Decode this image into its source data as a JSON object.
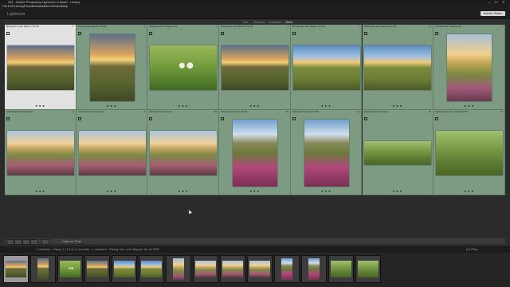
{
  "window": {
    "title": "361 - Adobe Photoshop Lightroom Classic - Library",
    "controls": [
      "—",
      "☐",
      "✕"
    ]
  },
  "menu": [
    "File",
    "Edit",
    "Library",
    "Photo",
    "Metadata",
    "View",
    "Window",
    "Help"
  ],
  "identity_plate": {
    "logo": "Lightroom",
    "share_label": "Adobe Share"
  },
  "library_filter": {
    "tabs": [
      "Text",
      "Attribute",
      "Metadata",
      "None"
    ],
    "active": "None"
  },
  "grid_rows": [
    [
      {
        "info": "Rising Sun over Rippon Tor #2",
        "num": "1",
        "selected": true,
        "orientation": "landscape",
        "scene": "sunset-hills"
      },
      {
        "info": "Sunrise over Rippon Tor #2",
        "num": "2",
        "orientation": "portrait",
        "scene": "sunset-hills"
      },
      {
        "info": "Mushrooms on Rippon Tor",
        "num": "3",
        "orientation": "landscape",
        "scene": "mushrooms"
      },
      {
        "info": "Rising Sun over Rippon Tor #1",
        "num": "4",
        "orientation": "landscape",
        "scene": "sunset-hills"
      },
      {
        "info": "Rising Sun over Rippon Tor #4",
        "num": "5",
        "orientation": "landscape",
        "scene": "blue-hills"
      },
      {
        "info": "Rising Sun over Rippon Tor #3",
        "num": "6",
        "orientation": "landscape",
        "scene": "blue-hills"
      },
      {
        "info": "Chinkwell Tor Sunrise #3",
        "num": "7",
        "orientation": "portrait",
        "scene": "heather-sunrise"
      }
    ],
    [
      {
        "info": "Chinkwell Tor Sunrise #2",
        "num": "8",
        "orientation": "landscape",
        "scene": "heather-rocks"
      },
      {
        "info": "Chinkwell Tor Sunrise #1",
        "num": "9",
        "orientation": "landscape",
        "scene": "heather-rocks"
      },
      {
        "info": "Chinkwell Tor Summit",
        "num": "10",
        "orientation": "landscape",
        "scene": "heather-rocks"
      },
      {
        "info": "Chinkwell Tor Summit #2",
        "num": "11",
        "orientation": "portrait",
        "scene": "heather-boulders"
      },
      {
        "info": "Chinkwell Tor Summit #3",
        "num": "12",
        "orientation": "portrait",
        "scene": "heather-boulders"
      },
      {
        "info": "Widecombe Panorama",
        "num": "13",
        "orientation": "panorama",
        "scene": "valley"
      },
      {
        "info": "Widecombe from Chinkwell Tor",
        "num": "14",
        "orientation": "landscape",
        "scene": "valley"
      }
    ]
  ],
  "toolbar": {
    "sort_label": "Capture Time"
  },
  "filmstrip_bar": {
    "breadcrumb": "Collection : Dtacy 1 | 14 of | Currently : 1 selected : Rising Sun over Rippon Tor #1.NEF",
    "filter_label": "No Filter"
  },
  "filmstrip": [
    {
      "scene": "sunset-hills",
      "orientation": "landscape",
      "selected": true
    },
    {
      "scene": "sunset-hills",
      "orientation": "portrait"
    },
    {
      "scene": "mushrooms",
      "orientation": "landscape"
    },
    {
      "scene": "sunset-hills",
      "orientation": "landscape"
    },
    {
      "scene": "blue-hills",
      "orientation": "landscape"
    },
    {
      "scene": "blue-hills",
      "orientation": "landscape"
    },
    {
      "scene": "heather-sunrise",
      "orientation": "portrait"
    },
    {
      "scene": "heather-rocks",
      "orientation": "landscape"
    },
    {
      "scene": "heather-rocks",
      "orientation": "landscape"
    },
    {
      "scene": "heather-rocks",
      "orientation": "landscape"
    },
    {
      "scene": "heather-boulders",
      "orientation": "portrait"
    },
    {
      "scene": "heather-boulders",
      "orientation": "portrait"
    },
    {
      "scene": "valley",
      "orientation": "landscape"
    },
    {
      "scene": "valley",
      "orientation": "landscape"
    }
  ],
  "colors": {
    "grid_cell": "#7d9a83",
    "grid_cell_selected": "#e1e1e1",
    "background": "#2b2b2b"
  },
  "rating_dots": "● ● ●"
}
